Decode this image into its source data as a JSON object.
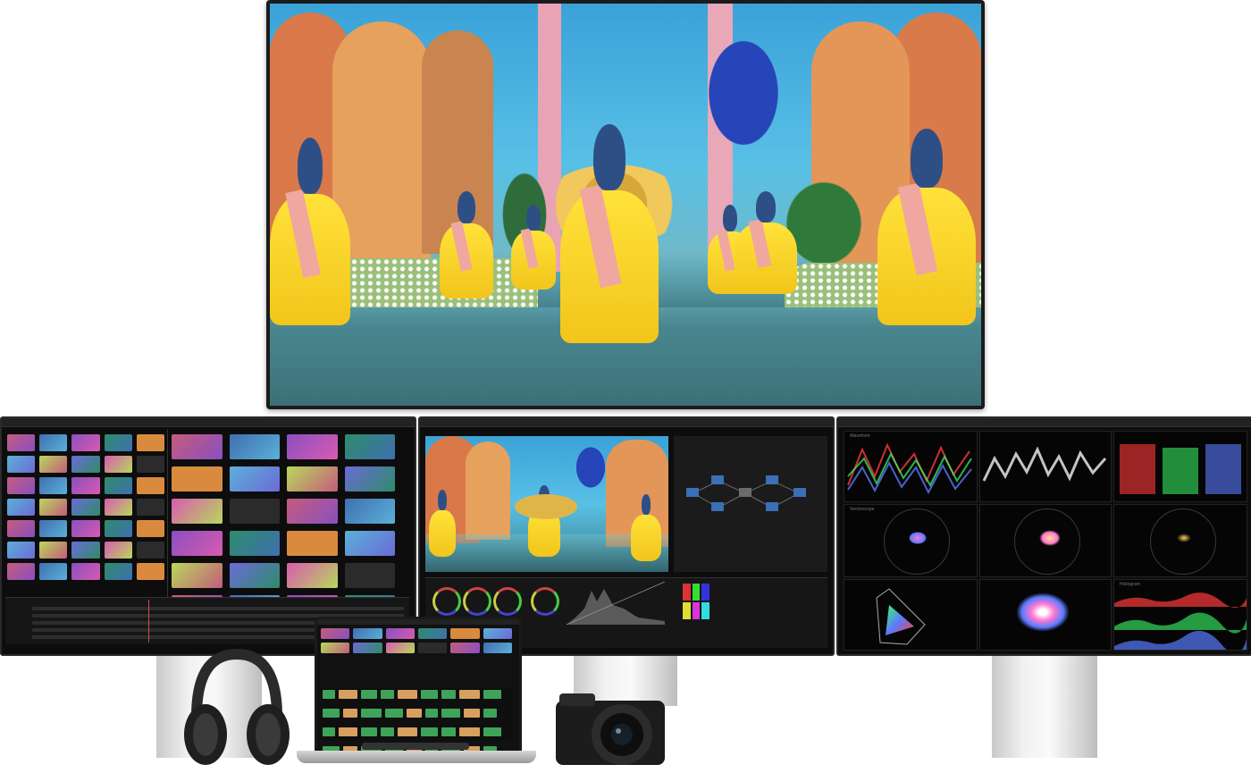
{
  "scene": {
    "tv": {
      "description_icon": "display-icon"
    },
    "left_monitor": {
      "app_panel": "media-pool"
    },
    "center_monitor": {
      "title": "",
      "colors": {
        "accent": "#e04a4a",
        "node": "#3b6fb6"
      }
    },
    "right_monitor": {
      "panels": [
        "Waveform",
        "Vectorscope",
        "Histogram"
      ]
    },
    "laptop": {},
    "accessories": [
      "headphones-icon",
      "camera-icon"
    ]
  },
  "colors": {
    "background": "#ffffff",
    "dancer_yellow": "#ffe23a",
    "sky_blue": "#3aa2d8",
    "scope_red": "#ff3b3b",
    "scope_green": "#3bff6a",
    "scope_blue": "#5a7bff"
  }
}
